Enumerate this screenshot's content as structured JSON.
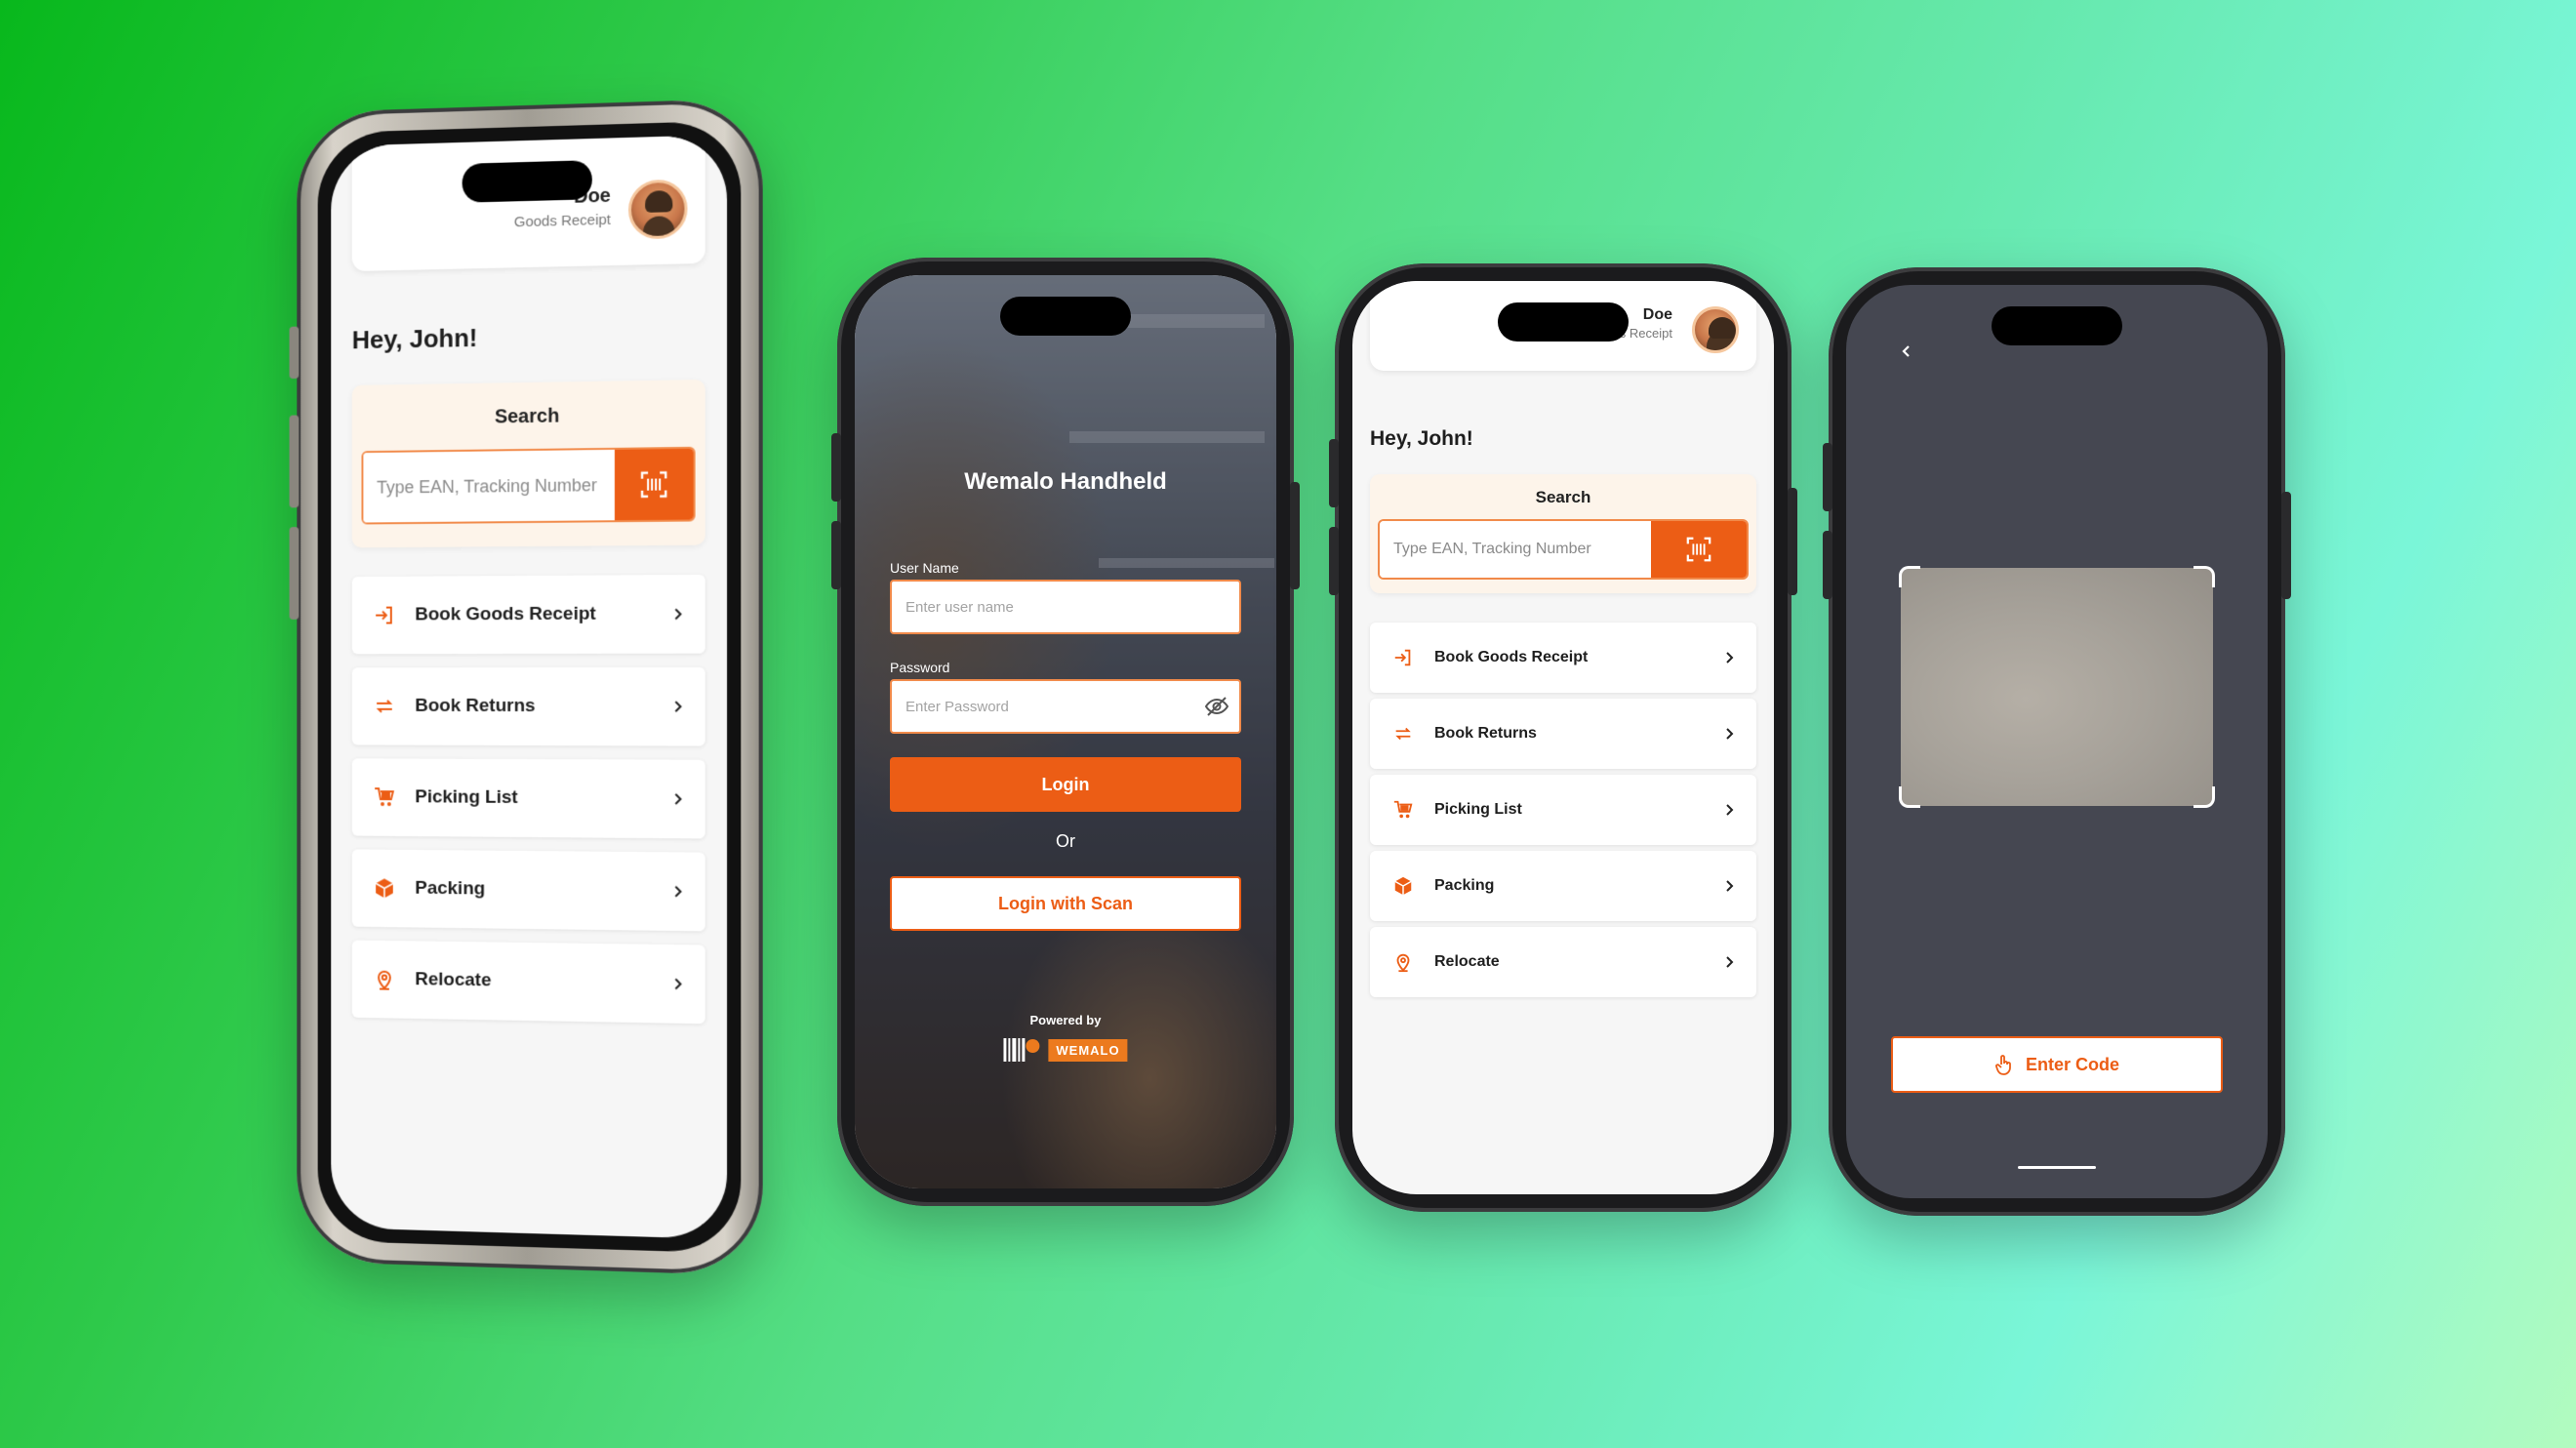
{
  "colors": {
    "accent": "#ec5d15",
    "accent_light": "#f18a4a",
    "search_card_bg": "#fdf4ea",
    "scanner_bg": "#454751"
  },
  "home": {
    "user_name": "Doe",
    "user_role": "Goods Receipt",
    "greeting": "Hey, John!",
    "search": {
      "title": "Search",
      "placeholder": "Type EAN, Tracking Number",
      "scan_icon": "barcode-scan-icon"
    },
    "menu": [
      {
        "label": "Book Goods Receipt",
        "icon": "login-arrow-icon"
      },
      {
        "label": "Book Returns",
        "icon": "repeat-icon"
      },
      {
        "label": "Picking List",
        "icon": "cart-icon"
      },
      {
        "label": "Packing",
        "icon": "box-icon"
      },
      {
        "label": "Relocate",
        "icon": "location-pin-icon"
      }
    ]
  },
  "login": {
    "title": "Wemalo Handheld",
    "username_label": "User Name",
    "username_placeholder": "Enter user name",
    "password_label": "Password",
    "password_placeholder": "Enter Password",
    "login_label": "Login",
    "or_label": "Or",
    "scan_login_label": "Login with Scan",
    "powered_by": "Powered by",
    "brand": "WEMALO"
  },
  "scanner": {
    "enter_code_label": "Enter Code",
    "enter_code_icon": "hand-pointer-icon",
    "back_icon": "chevron-left-icon"
  }
}
